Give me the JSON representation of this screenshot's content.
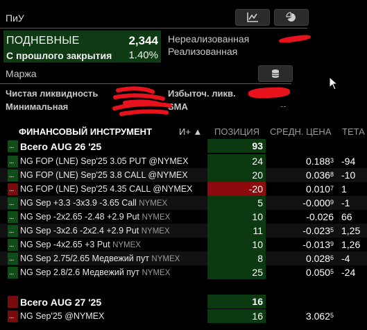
{
  "panel": {
    "title": "ПиУ",
    "daily_label": "ПОДНЕВНЫЕ",
    "daily_value": "2,344",
    "since_label": "С прошлого закрытия",
    "since_value": "1.40%",
    "unrealized_label": "Нереализованная",
    "realized_label": "Реализованная",
    "margin_label": "Маржа",
    "net_liq_label": "Чистая ликвидность",
    "minimal_label": "Минимальная",
    "excess_liq_label": "Избыточ. ликв.",
    "sma_label": "SMA",
    "sma_value": "--"
  },
  "icons": {
    "chart": "chart-icon",
    "pie": "pie-chart-icon",
    "coins": "coins-icon",
    "cursor": "mouse-cursor-icon"
  },
  "colors": {
    "positive_bg": "#0b3a10",
    "negative_bg": "#8e0b0d",
    "redaction": "#e8121c"
  },
  "table": {
    "headers": {
      "instrument": "ФИНАНСОВЫЙ ИНСТРУМЕНТ",
      "sort": "И+ ▲",
      "position": "ПОЗИЦИЯ",
      "avg_price": "СРЕДН. ЦЕНА",
      "theta": "ТЕТА"
    },
    "rows": [
      {
        "group": true,
        "indicator": "green",
        "ind_text": "...",
        "name": "Всего AUG 26 '25",
        "exch": "",
        "pos": "93",
        "avg": "",
        "avg_sup": "",
        "theta": ""
      },
      {
        "indicator": "green",
        "ind_text": "...",
        "name": "NG FOP (LNE) Sep'25 3.05 PUT @NYMEX",
        "exch": "",
        "pos": "24",
        "avg": "0.188",
        "avg_sup": "3",
        "theta": "-94"
      },
      {
        "indicator": "green",
        "ind_text": "...",
        "name": "NG FOP (LNE) Sep'25 3.8 CALL @NYMEX",
        "exch": "",
        "pos": "20",
        "avg": "0.036",
        "avg_sup": "8",
        "theta": "-10"
      },
      {
        "indicator": "red",
        "ind_text": "...",
        "name": "NG FOP (LNE) Sep'25 4.35 CALL @NYMEX",
        "exch": "",
        "pos": "-20",
        "neg": true,
        "avg": "0.010",
        "avg_sup": "7",
        "theta": "1"
      },
      {
        "indicator": "green",
        "ind_text": "...",
        "name": "NG Sep +3.3 -3x3.9 -3.65 Call ",
        "exch": "NYMEX",
        "pos": "5",
        "avg": "-0.000",
        "avg_sup": "9",
        "theta": "-1"
      },
      {
        "indicator": "green",
        "ind_text": "...",
        "name": "NG Sep -2x2.65 -2.48 +2.9 Put ",
        "exch": "NYMEX",
        "pos": "10",
        "avg": "-0.026",
        "avg_sup": "",
        "theta": "66"
      },
      {
        "indicator": "green",
        "ind_text": "...",
        "name": "NG Sep -3x2.6 -2x2.4 +2.9 Put ",
        "exch": "NYMEX",
        "pos": "11",
        "avg": "-0.023",
        "avg_sup": "5",
        "theta": "1,25"
      },
      {
        "indicator": "green",
        "ind_text": "...",
        "name": "NG Sep -4x2.65 +3 Put ",
        "exch": "NYMEX",
        "pos": "10",
        "avg": "-0.013",
        "avg_sup": "9",
        "theta": "1,26"
      },
      {
        "indicator": "green",
        "ind_text": "...",
        "name": "NG Sep 2.75/2.65 Медвежий пут ",
        "exch": "NYMEX",
        "pos": "8",
        "avg": "0.028",
        "avg_sup": "6",
        "theta": "-4"
      },
      {
        "indicator": "green",
        "ind_text": "...",
        "name": "NG Sep 2.8/2.6 Медвежий пут ",
        "exch": "NYMEX",
        "pos": "25",
        "avg": "0.050",
        "avg_sup": "5",
        "theta": "-24"
      },
      {
        "group": true,
        "indicator": "red",
        "ind_text": "",
        "name": "Всего AUG 27 '25",
        "exch": "",
        "pos": "16",
        "avg": "",
        "avg_sup": "",
        "theta": ""
      },
      {
        "indicator": "red",
        "ind_text": "...",
        "name": "NG Sep'25 @NYMEX",
        "exch": "",
        "pos": "16",
        "avg": "3.062",
        "avg_sup": "5",
        "theta": ""
      }
    ]
  }
}
